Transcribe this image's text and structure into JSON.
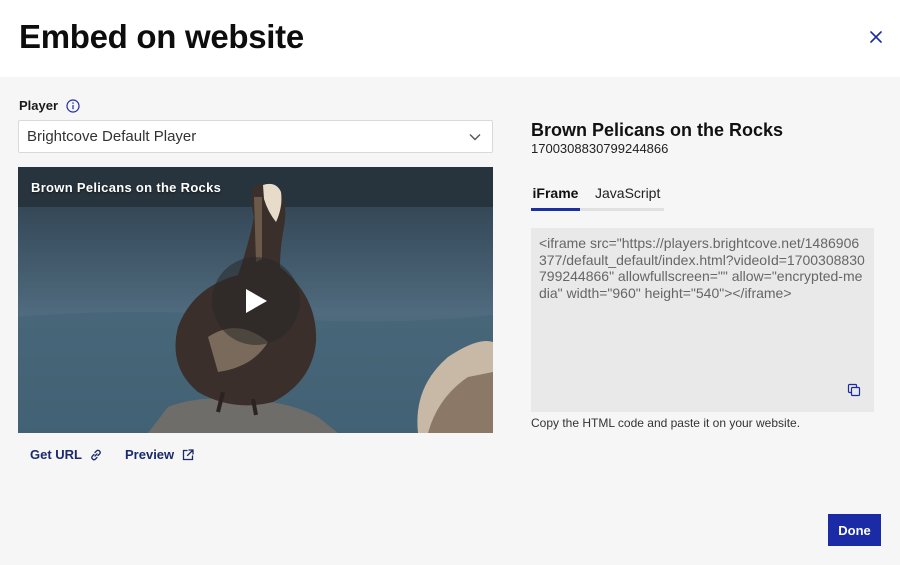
{
  "dialog": {
    "title": "Embed on website",
    "close_icon": "close-icon"
  },
  "player": {
    "label": "Player",
    "info_icon": "info-icon",
    "selected": "Brightcove Default Player"
  },
  "video": {
    "overlay_title": "Brown Pelicans on the Rocks",
    "play_icon": "play-icon"
  },
  "links": {
    "get_url": "Get URL",
    "preview": "Preview"
  },
  "details": {
    "title": "Brown Pelicans on the Rocks",
    "video_id": "1700308830799244866"
  },
  "tabs": [
    {
      "label": "iFrame",
      "active": true
    },
    {
      "label": "JavaScript",
      "active": false
    }
  ],
  "embed_code": "<iframe src=\"https://players.brightcove.net/1486906377/default_default/index.html?videoId=1700308830799244866\" allowfullscreen=\"\" allow=\"encrypted-media\" width=\"960\" height=\"540\"></iframe>",
  "helper_text": "Copy the HTML code and paste it on your website.",
  "done_label": "Done",
  "colors": {
    "accent": "#1b2ba6",
    "link": "#1a2a6c",
    "panel_bg": "#f6f6f6",
    "code_bg": "#e9e9e9"
  }
}
